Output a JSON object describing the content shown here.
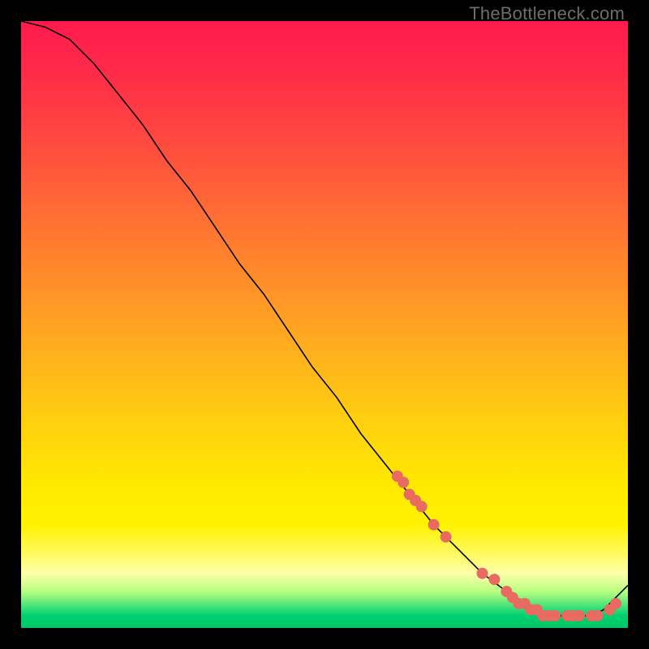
{
  "watermark": "TheBottleneck.com",
  "colors": {
    "marker": "#e86a60",
    "curve": "#000000",
    "background": "#000000"
  },
  "chart_data": {
    "type": "line",
    "title": "",
    "xlabel": "",
    "ylabel": "",
    "xlim": [
      0,
      100
    ],
    "ylim": [
      0,
      100
    ],
    "grid": false,
    "legend": false,
    "series": [
      {
        "name": "curve",
        "x": [
          0,
          4,
          8,
          12,
          16,
          20,
          24,
          28,
          32,
          36,
          40,
          44,
          48,
          52,
          56,
          60,
          64,
          68,
          72,
          76,
          80,
          84,
          86,
          88,
          90,
          92,
          94,
          96,
          98,
          100
        ],
        "y": [
          100,
          99,
          97,
          93,
          88,
          83,
          77,
          72,
          66,
          60,
          55,
          49,
          43,
          38,
          32,
          27,
          22,
          17,
          13,
          9,
          6,
          3,
          2,
          2,
          2,
          2,
          2,
          3,
          5,
          7
        ]
      }
    ],
    "markers": {
      "name": "highlighted-points",
      "x": [
        62,
        63,
        64,
        65,
        66,
        68,
        70,
        76,
        78,
        80,
        81,
        82,
        83,
        84,
        85,
        86,
        87,
        88,
        90,
        91,
        92,
        94,
        95,
        97,
        98
      ],
      "y": [
        25,
        24,
        22,
        21,
        20,
        17,
        15,
        9,
        8,
        6,
        5,
        4,
        4,
        3,
        3,
        2,
        2,
        2,
        2,
        2,
        2,
        2,
        2,
        3,
        4
      ]
    }
  }
}
